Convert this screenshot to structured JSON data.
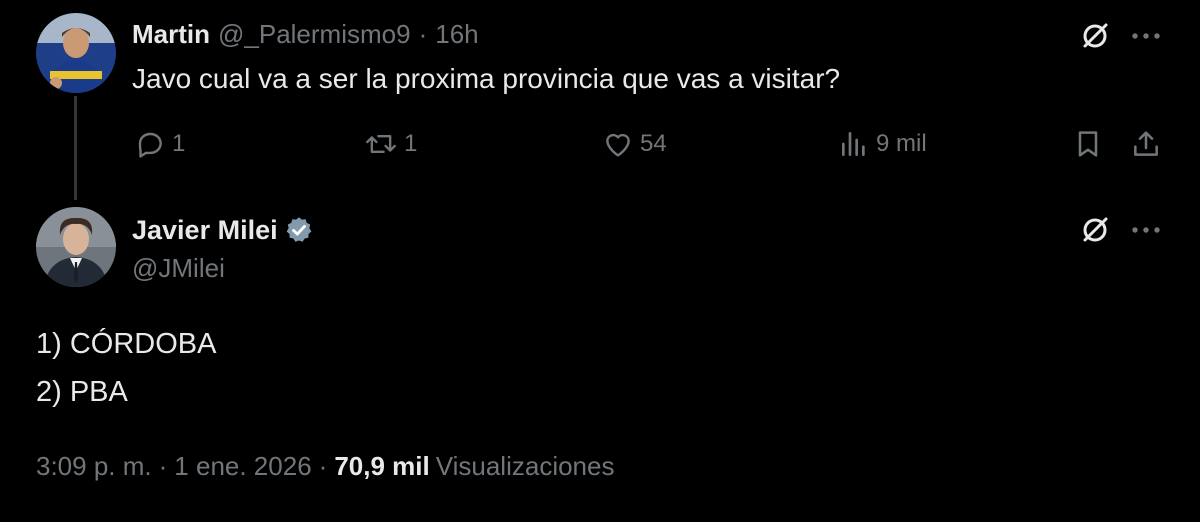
{
  "reply": {
    "name": "Martin",
    "handle": "@_Palermismo9",
    "separator": "·",
    "time": "16h",
    "text": "Javo cual va a ser la proxima provincia que vas a visitar?",
    "avatar_icon": "avatar-martin",
    "actions": {
      "replies": "1",
      "retweets": "1",
      "likes": "54",
      "views": "9 mil"
    }
  },
  "main_tweet": {
    "name": "Javier Milei",
    "handle": "@JMilei",
    "verified": true,
    "avatar_icon": "avatar-javier-milei",
    "lines": [
      "1) CÓRDOBA",
      "2) PBA"
    ],
    "meta": {
      "time": "3:09 p. m.",
      "separator": "·",
      "date": "1 ene. 2026",
      "views_count": "70,9 mil",
      "views_label": "Visualizaciones"
    }
  },
  "icons": {
    "grok": "grok-icon",
    "more": "more-icon",
    "reply": "reply-icon",
    "retweet": "retweet-icon",
    "like": "heart-icon",
    "views": "views-icon",
    "bookmark": "bookmark-icon",
    "share": "share-icon",
    "verified": "verified-badge-icon"
  },
  "colors": {
    "background": "#000000",
    "text_primary": "#e7e9ea",
    "text_secondary": "#71767b",
    "thread_line": "#333639",
    "verified_badge": "#829aab"
  }
}
